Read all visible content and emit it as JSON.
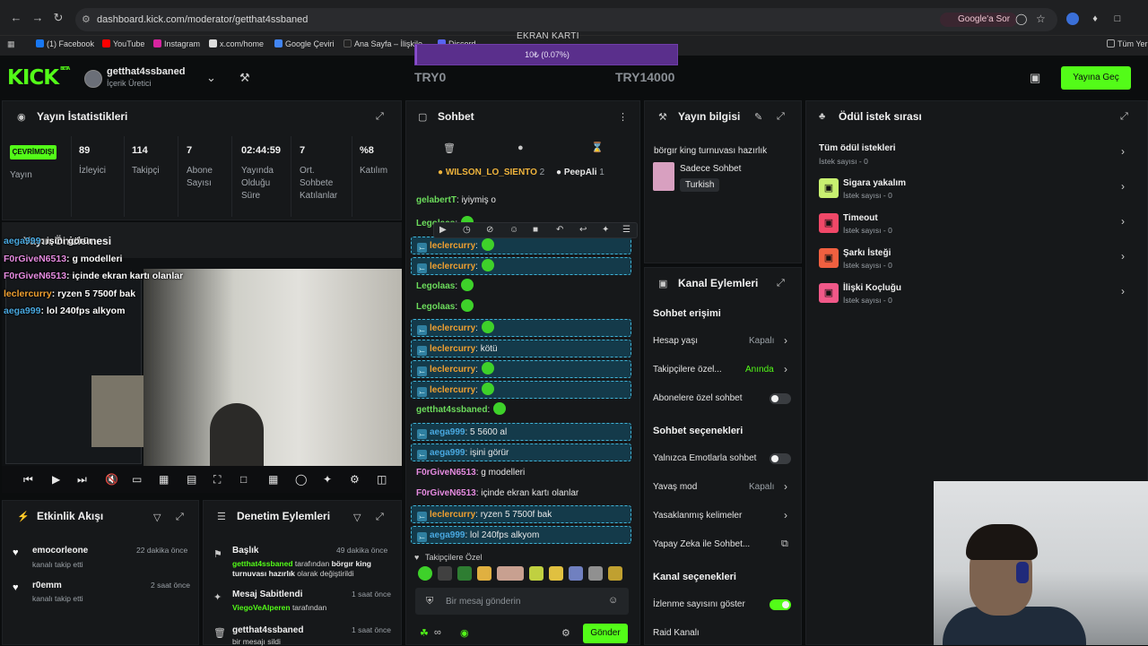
{
  "browser": {
    "url": "dashboard.kick.com/moderator/getthat4ssbaned",
    "google_sor": "Google'a Sor",
    "bookmarks": [
      "(1) Facebook",
      "YouTube",
      "Instagram",
      "x.com/home",
      "Google Çeviri",
      "Ana Sayfa – İlişkile...",
      "Discord"
    ],
    "bookmarks_right": "Tüm Yer"
  },
  "overlay": {
    "label": "EKRAN KARTI",
    "progress_text": "10₺ (0.07%)",
    "progress": 0.0007,
    "min": "TRY0",
    "max": "TRY14000"
  },
  "header": {
    "logo": "KICK",
    "logo_sup": "BETA",
    "username": "getthat4ssbaned",
    "role": "İçerik Üretici",
    "go_live": "Yayına Geç"
  },
  "stats_panel": {
    "title": "Yayın İstatistikleri",
    "status_badge": "ÇEVRİMDIŞI",
    "status_label": "Yayın",
    "stats": [
      {
        "value": "89",
        "label": "İzleyici"
      },
      {
        "value": "114",
        "label": "Takipçi"
      },
      {
        "value": "7",
        "label": "Abone Sayısı"
      },
      {
        "value": "02:44:59",
        "label": "Yayında Olduğu Süre"
      },
      {
        "value": "7",
        "label": "Ort. Sohbete Katılanlar"
      },
      {
        "value": "%8",
        "label": "Katılım"
      }
    ]
  },
  "preview": {
    "title": "Yayın Önizlemesi",
    "overlay_chat": [
      {
        "user": "aega999",
        "text": ": işini görür",
        "color": "#49a8e0"
      },
      {
        "user": "F0rGiveN6513",
        "text": ": g modelleri",
        "color": "#e68be0"
      },
      {
        "user": "F0rGiveN6513",
        "text": ": içinde ekran kartı olanlar",
        "color": "#e68be0"
      },
      {
        "user": "leclercurry",
        "text": ": ryzen 5 7500f bak",
        "color": "#f0a030"
      },
      {
        "user": "aega999",
        "text": ": lol 240fps alkyom",
        "color": "#49a8e0"
      }
    ]
  },
  "chat": {
    "title": "Sohbet",
    "pinned_users": [
      {
        "name": "WILSON_LO_SIENTO",
        "count": "2"
      },
      {
        "name": "PeepAli",
        "count": "1"
      }
    ],
    "messages": [
      {
        "user": "gelabertT",
        "text": ": iyiymiş o",
        "color": "#6cdc5c",
        "hl": false,
        "emote": false,
        "mod": false
      },
      {
        "user": "Legolaas",
        "text": ":",
        "color": "#6cdc5c",
        "hl": false,
        "emote": true,
        "mod": false
      },
      {
        "user": "leclercurry",
        "text": ":",
        "color": "#f0a030",
        "hl": true,
        "emote": true,
        "mod": true
      },
      {
        "user": "leclercurry",
        "text": ":",
        "color": "#f0a030",
        "hl": true,
        "emote": true,
        "mod": true
      },
      {
        "user": "Legolaas",
        "text": ":",
        "color": "#6cdc5c",
        "hl": false,
        "emote": true,
        "mod": false
      },
      {
        "user": "Legolaas",
        "text": ":",
        "color": "#6cdc5c",
        "hl": false,
        "emote": true,
        "mod": false
      },
      {
        "user": "leclercurry",
        "text": ":",
        "color": "#f0a030",
        "hl": true,
        "emote": true,
        "mod": true
      },
      {
        "user": "leclercurry",
        "text": ": kötü",
        "color": "#f0a030",
        "hl": true,
        "emote": false,
        "mod": true
      },
      {
        "user": "leclercurry",
        "text": ":",
        "color": "#f0a030",
        "hl": true,
        "emote": true,
        "mod": true
      },
      {
        "user": "leclercurry",
        "text": ":",
        "color": "#f0a030",
        "hl": true,
        "emote": true,
        "mod": true
      },
      {
        "user": "getthat4ssbaned",
        "text": ":",
        "color": "#6cdc5c",
        "hl": false,
        "emote": true,
        "mod": false
      },
      {
        "user": "aega999",
        "text": ": 5 5600 al",
        "color": "#49a8e0",
        "hl": true,
        "emote": false,
        "mod": true
      },
      {
        "user": "aega999",
        "text": ": işini görür",
        "color": "#49a8e0",
        "hl": true,
        "emote": false,
        "mod": true
      },
      {
        "user": "F0rGiveN6513",
        "text": ": g modelleri",
        "color": "#e68be0",
        "hl": false,
        "emote": false,
        "mod": false
      },
      {
        "user": "F0rGiveN6513",
        "text": ": içinde ekran kartı olanlar",
        "color": "#e68be0",
        "hl": false,
        "emote": false,
        "mod": false
      },
      {
        "user": "leclercurry",
        "text": ": ryzen 5 7500f bak",
        "color": "#f0a030",
        "hl": true,
        "emote": false,
        "mod": true
      },
      {
        "user": "aega999",
        "text": ": lol 240fps alkyom",
        "color": "#49a8e0",
        "hl": true,
        "emote": false,
        "mod": true
      }
    ],
    "followers_only_label": "Takipçilere Özel",
    "input_placeholder": "Bir mesaj gönderin",
    "send_label": "Gönder"
  },
  "stream_info": {
    "title": "Yayın bilgisi",
    "stream_title": "börgır king turnuvası hazırlık",
    "category": "Sadece Sohbet",
    "tag": "Turkish"
  },
  "channel_actions": {
    "title": "Kanal Eylemleri",
    "chat_access": "Sohbet erişimi",
    "account_age": {
      "label": "Hesap yaşı",
      "value": "Kapalı"
    },
    "followers": {
      "label": "Takipçilere özel...",
      "value": "Anında"
    },
    "subs_only": "Abonelere özel sohbet",
    "chat_options": "Sohbet seçenekleri",
    "emotes_only": "Yalnızca Emotlarla sohbet",
    "slow_mode": {
      "label": "Yavaş mod",
      "value": "Kapalı"
    },
    "banned_words": "Yasaklanmış kelimeler",
    "ai_chat": "Yapay Zeka ile Sohbet...",
    "channel_options": "Kanal seçenekleri",
    "show_viewers": "İzlenme sayısını göster",
    "raid": "Raid Kanalı"
  },
  "rewards": {
    "title": "Ödül istek sırası",
    "items": [
      {
        "title": "Tüm ödül istekleri",
        "sub": "İstek sayısı - 0",
        "color": ""
      },
      {
        "title": "Sigara yakalım",
        "sub": "İstek sayısı - 0",
        "color": "#c8f070"
      },
      {
        "title": "Timeout",
        "sub": "İstek sayısı - 0",
        "color": "#f04868"
      },
      {
        "title": "Şarkı İsteği",
        "sub": "İstek sayısı - 0",
        "color": "#f06040"
      },
      {
        "title": "İlişki Koçluğu",
        "sub": "İstek sayısı - 0",
        "color": "#f05888"
      }
    ]
  },
  "activity": {
    "title": "Etkinlik Akışı",
    "items": [
      {
        "name": "emocorleone",
        "sub": "kanalı takip etti",
        "time": "22 dakika önce"
      },
      {
        "name": "r0emm",
        "sub": "kanalı takip etti",
        "time": "2 saat önce"
      }
    ]
  },
  "mod_actions": {
    "title": "Denetim Eylemleri",
    "items": [
      {
        "title": "Başlık",
        "time": "49 dakika önce",
        "l1a": "getthat4ssbaned",
        "l1b": " tarafından ",
        "l1c": "börgır king",
        "l2a": "turnuvası hazırlık",
        "l2b": " olarak değiştirildi"
      },
      {
        "title": "Mesaj Sabitlendi",
        "time": "1 saat önce",
        "l1a": "ViegoVeAlperen",
        "l1b": " tarafından"
      },
      {
        "title": "getthat4ssbaned",
        "time": "1 saat önce",
        "l1b": "bir mesajı sildi"
      }
    ]
  }
}
